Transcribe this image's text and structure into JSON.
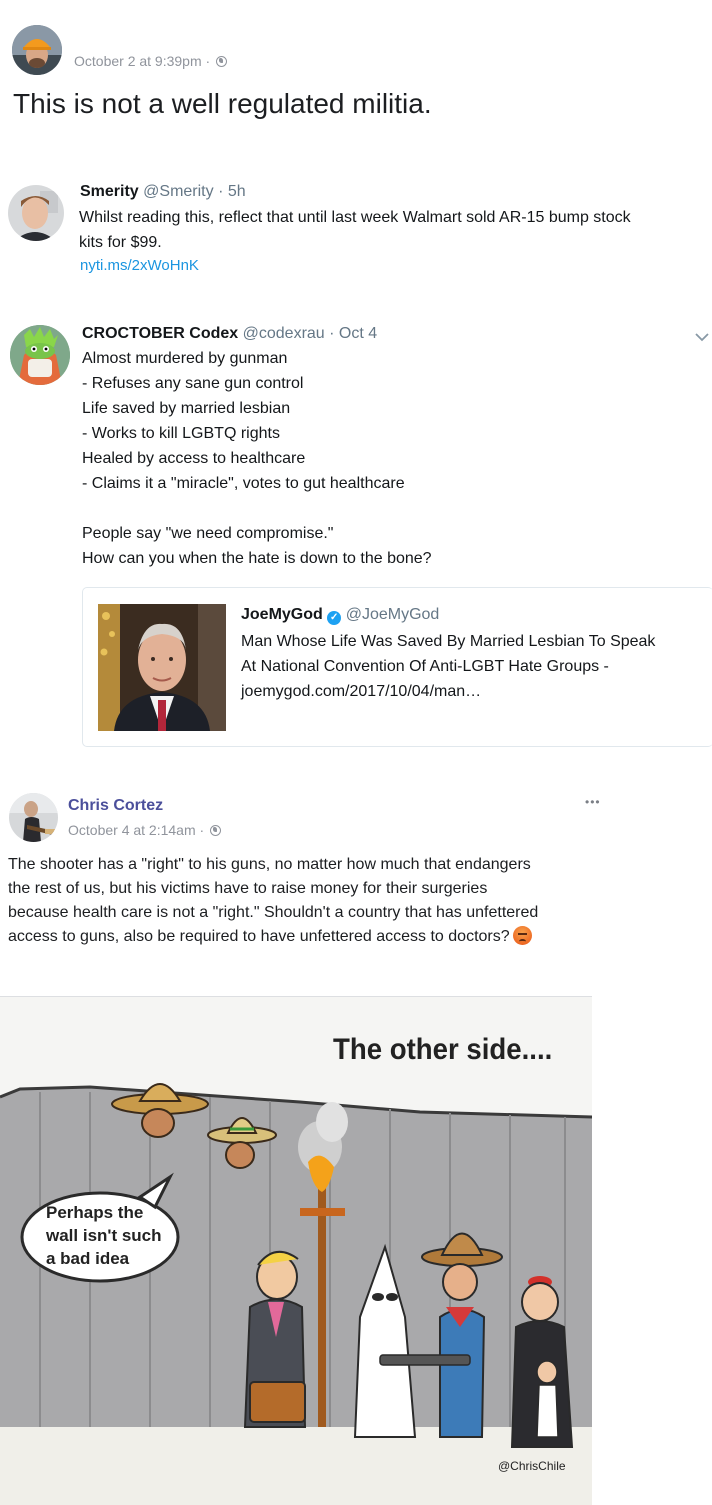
{
  "post1": {
    "timestamp": "October 2 at 9:39pm ·",
    "text": "This is not a well regulated militia."
  },
  "tweet1": {
    "name": "Smerity",
    "handle": "@Smerity · 5h",
    "text_line1": "Whilst reading this, reflect that until last week Walmart sold AR-15 bump stock",
    "text_line2": "kits for $99.",
    "link": "nyti.ms/2xWoHnK"
  },
  "tweet2": {
    "name": "CROCTOBER Codex",
    "handle": "@codexrau · Oct 4",
    "lines": [
      "Almost murdered by gunman",
      "- Refuses any sane gun control",
      "Life saved by married lesbian",
      "- Works to kill LGBTQ rights",
      "Healed by access to healthcare",
      "- Claims it a \"miracle\", votes to gut healthcare"
    ],
    "lines2": [
      "People say \"we need compromise.\"",
      "How can you when the hate is down to the bone?"
    ],
    "card": {
      "name": "JoeMyGod",
      "handle": "@JoeMyGod",
      "title_line1": "Man Whose Life Was Saved By Married Lesbian To Speak",
      "title_line2": "At National Convention Of Anti-LGBT Hate Groups -",
      "url": "joemygod.com/2017/10/04/man…"
    }
  },
  "fbpost": {
    "name": "Chris Cortez",
    "timestamp": "October 4 at 2:14am ·",
    "more": "•••",
    "lines": [
      "The shooter has a \"right\" to his guns, no matter how much that endangers",
      "the rest of us, but his victims have to raise money for their surgeries",
      "because health care is not a \"right.\" Shouldn't a country that has unfettered",
      "access to guns, also be required to have unfettered access to doctors?"
    ]
  },
  "cartoon": {
    "title": "The other side....",
    "bubble_line1": "Perhaps the",
    "bubble_line2": "wall isn't such",
    "bubble_line3": "a bad idea",
    "credit": "@ChrisChile"
  }
}
